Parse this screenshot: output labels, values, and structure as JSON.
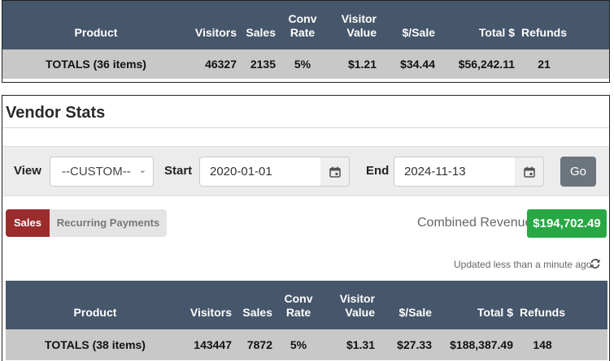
{
  "top_table": {
    "headers": {
      "product": "Product",
      "visitors": "Visitors",
      "sales": "Sales",
      "conv_rate_1": "Conv",
      "conv_rate_2": "Rate",
      "visitor_value_1": "Visitor",
      "visitor_value_2": "Value",
      "per_sale": "$/Sale",
      "total": "Total $",
      "refunds": "Refunds"
    },
    "totals": {
      "product": "TOTALS (36 items)",
      "visitors": "46327",
      "sales": "2135",
      "conv_rate": "5%",
      "visitor_value": "$1.21",
      "per_sale": "$34.44",
      "total": "$56,242.11",
      "refunds": "21"
    }
  },
  "vendor": {
    "title": "Vendor Stats",
    "filters": {
      "view_label": "View",
      "view_value": "--CUSTOM--",
      "start_label": "Start",
      "start_value": "2020-01-01",
      "end_label": "End",
      "end_value": "2024-11-13",
      "go_label": "Go"
    },
    "tabs": {
      "sales": "Sales",
      "recurring": "Recurring Payments"
    },
    "combined_revenue_label": "Combined Revenue:",
    "combined_revenue_value": "$194,702.49",
    "updated_text": "Updated less than a minute ago",
    "colors": {
      "header_bg": "#46566b",
      "sales_tab": "#9b2c2c",
      "revenue_badge": "#27a844",
      "go_button": "#6c757d"
    }
  },
  "bottom_table": {
    "headers": {
      "product": "Product",
      "visitors": "Visitors",
      "sales": "Sales",
      "conv_rate_1": "Conv",
      "conv_rate_2": "Rate",
      "visitor_value_1": "Visitor",
      "visitor_value_2": "Value",
      "per_sale": "$/Sale",
      "total": "Total $",
      "refunds": "Refunds"
    },
    "totals": {
      "product": "TOTALS (38 items)",
      "visitors": "143447",
      "sales": "7872",
      "conv_rate": "5%",
      "visitor_value": "$1.31",
      "per_sale": "$27.33",
      "total": "$188,387.49",
      "refunds": "148"
    }
  }
}
